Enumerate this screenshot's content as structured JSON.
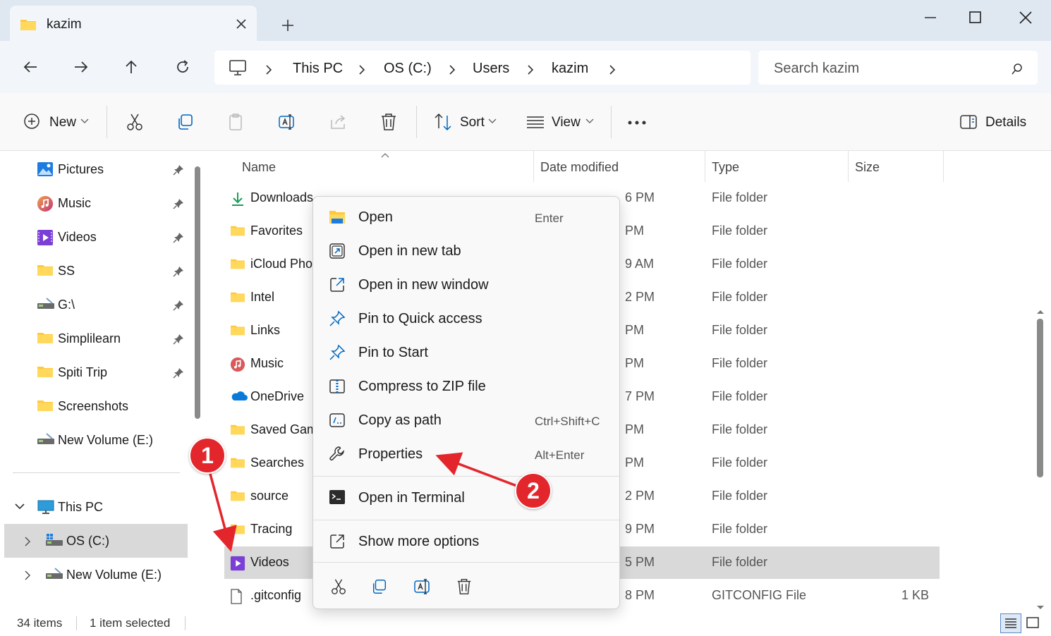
{
  "window": {
    "tab_title": "kazim",
    "colors": {
      "accent": "#0067c0",
      "folder": "#ffc93c",
      "annotation": "#e3262c",
      "selected_row": "#d9d9d9"
    }
  },
  "address": {
    "crumbs": [
      "This PC",
      "OS (C:)",
      "Users",
      "kazim"
    ]
  },
  "search": {
    "placeholder": "Search kazim"
  },
  "toolbar": {
    "new_label": "New",
    "sort_label": "Sort",
    "view_label": "View",
    "details_label": "Details"
  },
  "sidebar": {
    "quick_access": [
      {
        "label": "Pictures",
        "icon": "pictures-icon"
      },
      {
        "label": "Music",
        "icon": "music-icon"
      },
      {
        "label": "Videos",
        "icon": "videos-icon"
      },
      {
        "label": "SS",
        "icon": "folder-icon"
      },
      {
        "label": "G:\\",
        "icon": "drive-icon"
      },
      {
        "label": "Simplilearn",
        "icon": "folder-icon"
      },
      {
        "label": "Spiti Trip",
        "icon": "folder-icon"
      },
      {
        "label": "Screenshots",
        "icon": "folder-icon"
      },
      {
        "label": "New Volume (E:)",
        "icon": "drive-icon"
      }
    ],
    "tree": [
      {
        "label": "This PC",
        "icon": "pc-icon",
        "expanded": true
      },
      {
        "label": "OS (C:)",
        "icon": "drive-icon",
        "selected": true
      },
      {
        "label": "New Volume (E:)",
        "icon": "drive-icon"
      }
    ]
  },
  "list": {
    "columns": [
      "Name",
      "Date modified",
      "Type",
      "Size"
    ],
    "rows": [
      {
        "name": "Downloads",
        "date": "",
        "date_tail": "6 PM",
        "type": "File folder",
        "size": "",
        "icon": "downloads-icon"
      },
      {
        "name": "Favorites",
        "date_tail": "PM",
        "type": "File folder",
        "size": "",
        "icon": "folder-icon"
      },
      {
        "name": "iCloud Pho",
        "date_tail": "9 AM",
        "type": "File folder",
        "size": "",
        "icon": "folder-icon"
      },
      {
        "name": "Intel",
        "date_tail": "2 PM",
        "type": "File folder",
        "size": "",
        "icon": "folder-icon"
      },
      {
        "name": "Links",
        "date_tail": "PM",
        "type": "File folder",
        "size": "",
        "icon": "folder-icon"
      },
      {
        "name": "Music",
        "date_tail": "PM",
        "type": "File folder",
        "size": "",
        "icon": "music-icon"
      },
      {
        "name": "OneDrive",
        "date_tail": "7 PM",
        "type": "File folder",
        "size": "",
        "icon": "onedrive-icon"
      },
      {
        "name": "Saved Gam",
        "date_tail": "PM",
        "type": "File folder",
        "size": "",
        "icon": "folder-icon"
      },
      {
        "name": "Searches",
        "date_tail": "PM",
        "type": "File folder",
        "size": "",
        "icon": "folder-icon"
      },
      {
        "name": "source",
        "date_tail": "2 PM",
        "type": "File folder",
        "size": "",
        "icon": "folder-icon"
      },
      {
        "name": "Tracing",
        "date_tail": "9 PM",
        "type": "File folder",
        "size": "",
        "icon": "folder-icon"
      },
      {
        "name": "Videos",
        "date_tail": "5 PM",
        "type": "File folder",
        "size": "",
        "icon": "videos-icon",
        "selected": true
      },
      {
        "name": ".gitconfig",
        "date_tail": "8 PM",
        "type": "GITCONFIG File",
        "size": "1 KB",
        "icon": "file-icon"
      }
    ]
  },
  "context_menu": {
    "items": [
      {
        "label": "Open",
        "shortcut": "Enter",
        "icon": "open-folder-icon"
      },
      {
        "label": "Open in new tab",
        "shortcut": "",
        "icon": "new-tab-icon"
      },
      {
        "label": "Open in new window",
        "shortcut": "",
        "icon": "new-window-icon"
      },
      {
        "label": "Pin to Quick access",
        "shortcut": "",
        "icon": "pin-icon"
      },
      {
        "label": "Pin to Start",
        "shortcut": "",
        "icon": "pin-icon"
      },
      {
        "label": "Compress to ZIP file",
        "shortcut": "",
        "icon": "zip-icon"
      },
      {
        "label": "Copy as path",
        "shortcut": "Ctrl+Shift+C",
        "icon": "copy-path-icon"
      },
      {
        "label": "Properties",
        "shortcut": "Alt+Enter",
        "icon": "wrench-icon"
      },
      {
        "label": "Open in Terminal",
        "shortcut": "",
        "icon": "terminal-icon"
      },
      {
        "label": "Show more options",
        "shortcut": "",
        "icon": "more-options-icon"
      }
    ]
  },
  "status": {
    "count": "34 items",
    "selection": "1 item selected"
  },
  "annotations": {
    "badge1": "1",
    "badge2": "2"
  }
}
